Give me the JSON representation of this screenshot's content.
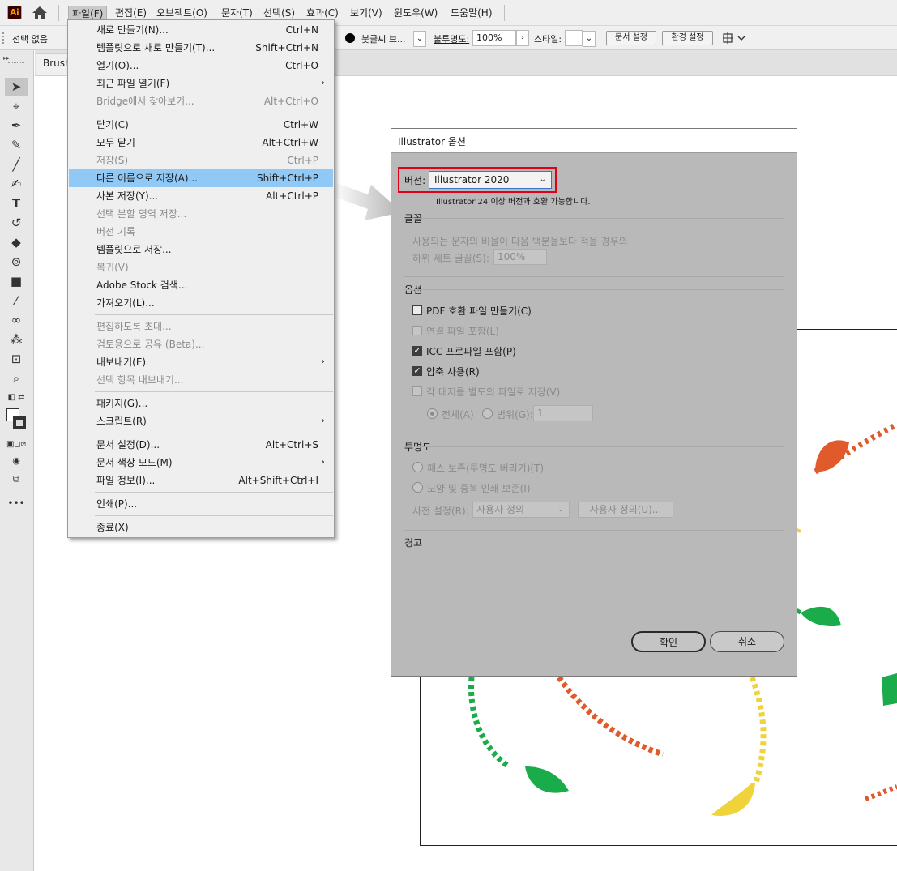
{
  "app": {
    "logo_text": "Ai"
  },
  "menubar": {
    "items": [
      "파일(F)",
      "편집(E)",
      "오브젝트(O)",
      "문자(T)",
      "선택(S)",
      "효과(C)",
      "보기(V)",
      "윈도우(W)",
      "도움말(H)"
    ]
  },
  "controlbar": {
    "selection": "선택 없음",
    "brush": "붓글씨 브...",
    "opacity_label": "불투명도:",
    "opacity_value": "100%",
    "style_label": "스타일:",
    "doc_setup": "문서 설정",
    "preferences": "환경 설정"
  },
  "document": {
    "tab_label": "Brush"
  },
  "file_menu": {
    "items": [
      {
        "label": "새로 만들기(N)...",
        "shortcut": "Ctrl+N"
      },
      {
        "label": "템플릿으로 새로 만들기(T)...",
        "shortcut": "Shift+Ctrl+N"
      },
      {
        "label": "열기(O)...",
        "shortcut": "Ctrl+O"
      },
      {
        "label": "최근 파일 열기(F)",
        "shortcut": ""
      },
      {
        "label": "Bridge에서 찾아보기...",
        "shortcut": "Alt+Ctrl+O"
      },
      {
        "label": "닫기(C)",
        "shortcut": "Ctrl+W"
      },
      {
        "label": "모두 닫기",
        "shortcut": "Alt+Ctrl+W"
      },
      {
        "label": "저장(S)",
        "shortcut": "Ctrl+P"
      },
      {
        "label": "다른 이름으로 저장(A)...",
        "shortcut": "Shift+Ctrl+P"
      },
      {
        "label": "사본 저장(Y)...",
        "shortcut": "Alt+Ctrl+P"
      },
      {
        "label": "선택 분할 영역 저장...",
        "shortcut": ""
      },
      {
        "label": "버전 기록",
        "shortcut": ""
      },
      {
        "label": "템플릿으로 저장...",
        "shortcut": ""
      },
      {
        "label": "복귀(V)",
        "shortcut": ""
      },
      {
        "label": "Adobe Stock 검색...",
        "shortcut": ""
      },
      {
        "label": "가져오기(L)...",
        "shortcut": ""
      },
      {
        "label": "편집하도록 초대...",
        "shortcut": ""
      },
      {
        "label": "검토용으로 공유 (Beta)...",
        "shortcut": ""
      },
      {
        "label": "내보내기(E)",
        "shortcut": ""
      },
      {
        "label": "선택 항목 내보내기...",
        "shortcut": ""
      },
      {
        "label": "패키지(G)...",
        "shortcut": ""
      },
      {
        "label": "스크립트(R)",
        "shortcut": ""
      },
      {
        "label": "문서 설정(D)...",
        "shortcut": "Alt+Ctrl+S"
      },
      {
        "label": "문서 색상 모드(M)",
        "shortcut": ""
      },
      {
        "label": "파일 정보(I)...",
        "shortcut": "Alt+Shift+Ctrl+I"
      },
      {
        "label": "인쇄(P)...",
        "shortcut": ""
      },
      {
        "label": "종료(X)",
        "shortcut": ""
      }
    ]
  },
  "dialog": {
    "title": "Illustrator 옵션",
    "version_label": "버전:",
    "version_value": "Illustrator 2020",
    "version_note": "Illustrator 24 이상 버전과 호환 가능합니다.",
    "fonts_group": "글꼴",
    "fonts_line1": "사용되는 문자의 비율이 다음 백분율보다 적을 경우의",
    "fonts_line2": "하위 세트 글꼴(S):",
    "fonts_value": "100%",
    "options_group": "옵션",
    "opt_pdf": "PDF 호환 파일 만들기(C)",
    "opt_linked": "연결 파일 포함(L)",
    "opt_icc": "ICC 프로파일 포함(P)",
    "opt_compress": "압축 사용(R)",
    "opt_artboards": "각 대지를 별도의 파일로 저장(V)",
    "opt_all": "전체(A)",
    "opt_range": "범위(G):",
    "opt_range_value": "1",
    "transparency_group": "투명도",
    "tr_paths": "패스 보존(투명도 버리기)(T)",
    "tr_appearance": "모양 및 중복 인쇄 보존(I)",
    "tr_preset_label": "사전 설정(R):",
    "tr_preset_value": "사용자 정의",
    "tr_custom_btn": "사용자 정의(U)...",
    "warning_group": "경고",
    "ok": "확인",
    "cancel": "취소"
  },
  "colors": {
    "highlight": "#90c8f6",
    "version_box": "#e0001a",
    "orange": "#e05a2b",
    "green": "#1aab4a",
    "yellow": "#f0d23a"
  }
}
